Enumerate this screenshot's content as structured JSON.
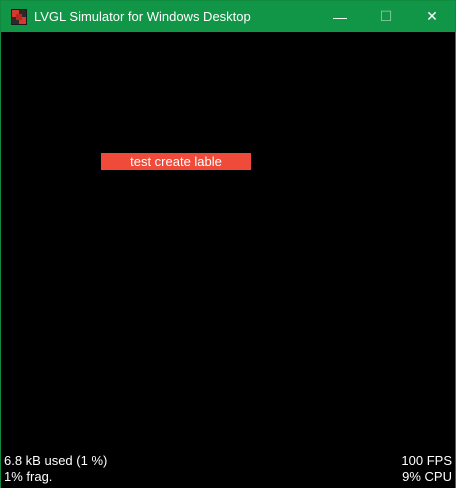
{
  "window": {
    "title": "LVGL Simulator for Windows Desktop",
    "minimize_glyph": "—",
    "maximize_glyph": "☐",
    "close_glyph": "✕"
  },
  "app_icon": "lvgl-logo-icon",
  "colors": {
    "titlebar": "#119546",
    "label_background": "#f04a3a",
    "screen_background": "#000000"
  },
  "screen": {
    "label_text": "test create lable"
  },
  "monitor": {
    "memory_used": "6.8 kB used (1 %)",
    "fragmentation": "1% frag.",
    "fps": "100 FPS",
    "cpu": "9% CPU"
  }
}
